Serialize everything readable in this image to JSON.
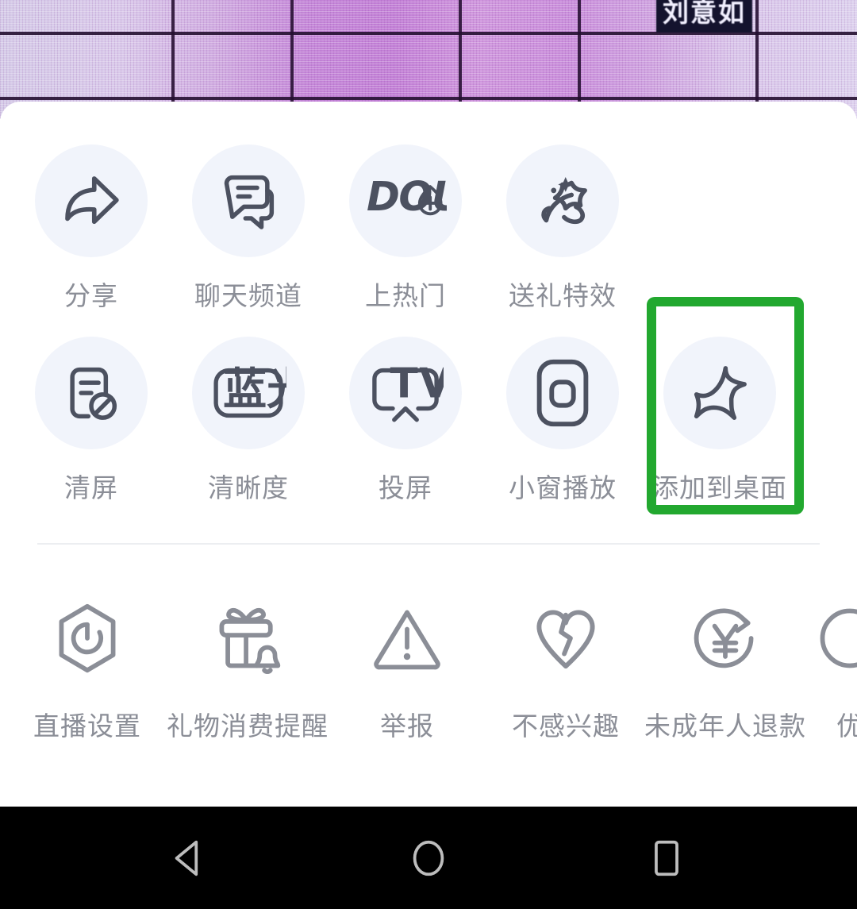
{
  "background": {
    "stream_name_tag": "刘意如"
  },
  "sheet": {
    "grid": {
      "row1": [
        {
          "label": "分享",
          "icon": "share-arrow-icon"
        },
        {
          "label": "聊天频道",
          "icon": "chat-bubbles-icon"
        },
        {
          "label": "上热门",
          "icon": "dou-plus-icon"
        },
        {
          "label": "送礼特效",
          "icon": "gift-effect-star-icon"
        }
      ],
      "row2": [
        {
          "label": "清屏",
          "icon": "clear-screen-icon"
        },
        {
          "label": "清晰度",
          "icon": "bluray-quality-icon",
          "badge": "蓝光"
        },
        {
          "label": "投屏",
          "icon": "tv-cast-icon",
          "badge": "TV"
        },
        {
          "label": "小窗播放",
          "icon": "picture-in-picture-icon"
        },
        {
          "label": "添加到桌面",
          "icon": "pin-icon",
          "highlighted": true
        }
      ]
    },
    "strip": [
      {
        "label": "直播设置",
        "icon": "hexagon-gear-icon"
      },
      {
        "label": "礼物消费提醒",
        "icon": "gift-bell-icon"
      },
      {
        "label": "举报",
        "icon": "warning-triangle-icon"
      },
      {
        "label": "不感兴趣",
        "icon": "broken-heart-icon"
      },
      {
        "label": "未成年人退款",
        "icon": "yuan-refund-icon"
      },
      {
        "label": "优",
        "icon": "clipped-icon"
      }
    ]
  },
  "navbar": {
    "back": "back-triangle-icon",
    "home": "home-circle-icon",
    "recents": "recents-square-icon"
  },
  "colors": {
    "highlight_green": "#22a82f",
    "icon_circle_bg": "#f1f4fb",
    "icon_stroke": "#4c5160",
    "label_text": "#8b8e97",
    "strip_icon_stroke": "#8b8e97"
  }
}
